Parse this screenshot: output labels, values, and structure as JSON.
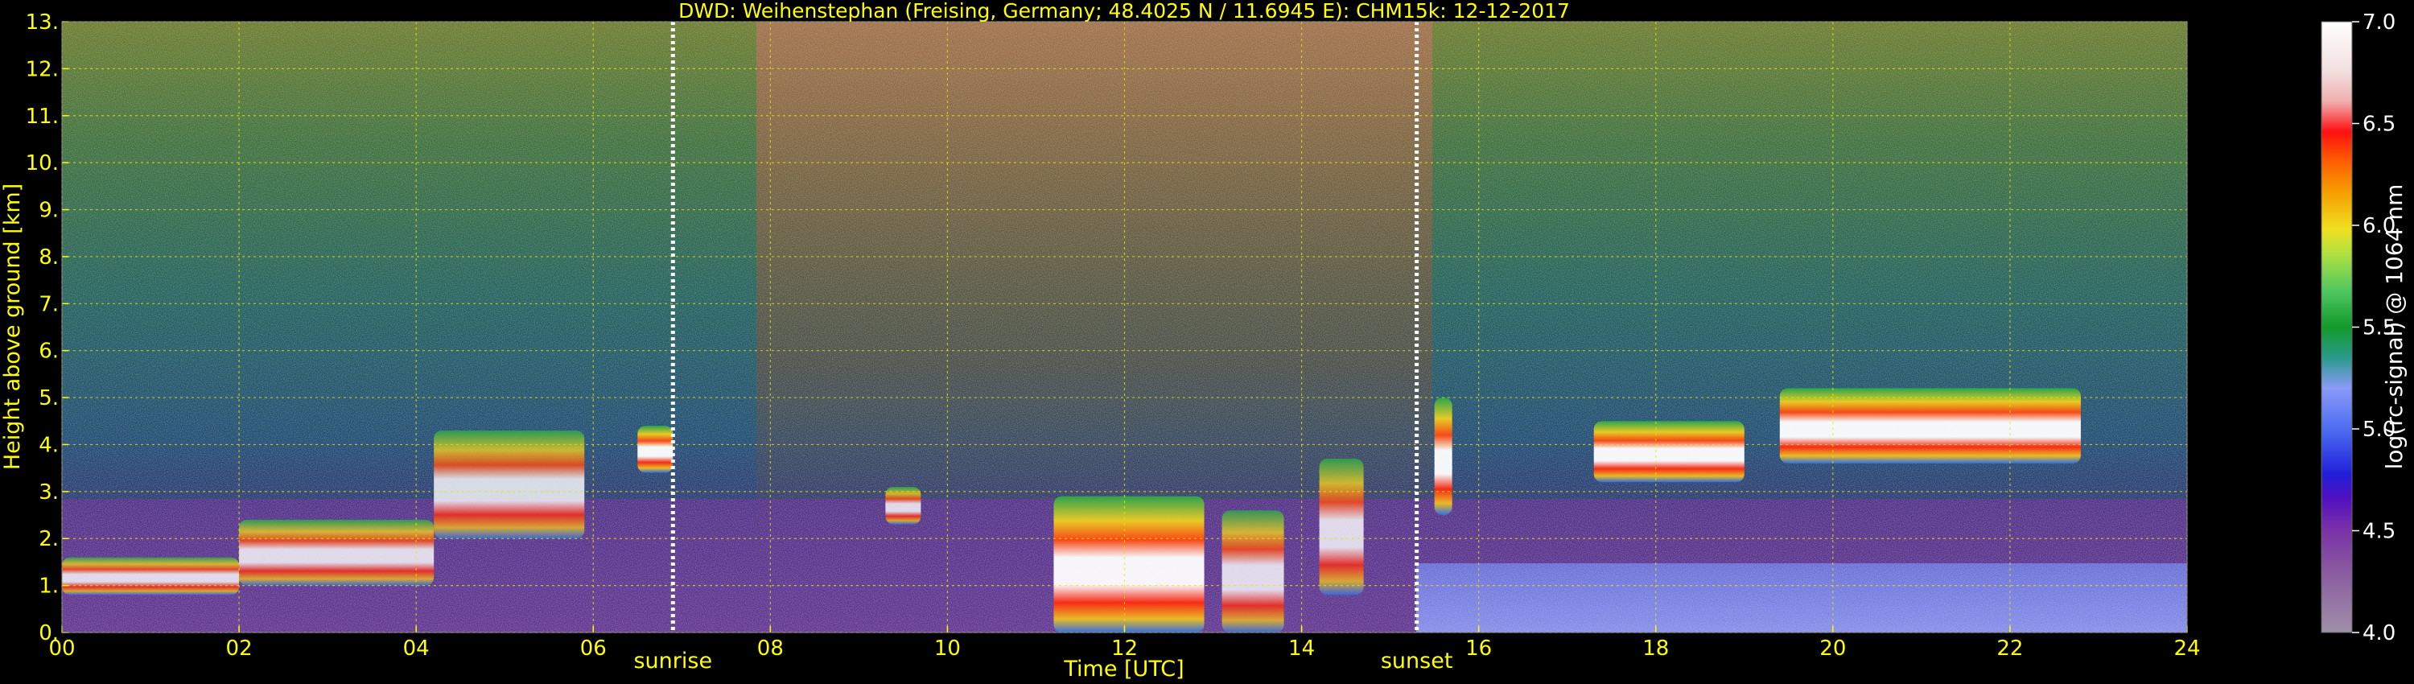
{
  "chart_data": {
    "type": "heatmap",
    "title": "DWD: Weihenstephan (Freising, Germany; 48.4025 N / 11.6945 E):    CHM15k: 12-12-2017",
    "xlabel": "Time [UTC]",
    "ylabel": "Height above ground [km]",
    "colorbar_label": "log(rc-signal) @ 1064 nm",
    "xlim": [
      0,
      24
    ],
    "ylim": [
      0,
      13
    ],
    "clim": [
      4.0,
      7.0
    ],
    "x_ticks": [
      "00",
      "02",
      "04",
      "06",
      "08",
      "10",
      "12",
      "14",
      "16",
      "18",
      "20",
      "22",
      "24"
    ],
    "y_ticks": [
      "0.",
      "1.",
      "2.",
      "3.",
      "4.",
      "5.",
      "6.",
      "7.",
      "8.",
      "9.",
      "10.",
      "11.",
      "12.",
      "13."
    ],
    "colorbar_ticks": [
      "4.0",
      "4.5",
      "5.0",
      "5.5",
      "6.0",
      "6.5",
      "7.0"
    ],
    "grid": true,
    "markers": [
      {
        "label": "sunrise",
        "time": 6.9
      },
      {
        "label": "sunset",
        "time": 15.3
      }
    ],
    "layers": [
      {
        "start": 0.0,
        "end": 2.0,
        "base": 0.8,
        "top": 1.6,
        "value": 6.3
      },
      {
        "start": 2.0,
        "end": 4.2,
        "base": 1.0,
        "top": 2.4,
        "value": 6.2
      },
      {
        "start": 4.2,
        "end": 5.9,
        "base": 2.0,
        "top": 4.3,
        "value": 6.0
      },
      {
        "start": 6.5,
        "end": 6.9,
        "base": 3.4,
        "top": 4.4,
        "value": 6.5
      },
      {
        "start": 9.3,
        "end": 9.7,
        "base": 2.3,
        "top": 3.1,
        "value": 5.8
      },
      {
        "start": 11.2,
        "end": 12.9,
        "base": 0.0,
        "top": 2.9,
        "value": 6.5
      },
      {
        "start": 13.1,
        "end": 13.8,
        "base": 0.0,
        "top": 2.6,
        "value": 6.0
      },
      {
        "start": 14.2,
        "end": 14.7,
        "base": 0.8,
        "top": 3.7,
        "value": 6.2
      },
      {
        "start": 15.5,
        "end": 15.7,
        "base": 2.5,
        "top": 5.0,
        "value": 6.5
      },
      {
        "start": 17.3,
        "end": 19.0,
        "base": 3.2,
        "top": 4.5,
        "value": 6.8
      },
      {
        "start": 19.4,
        "end": 22.8,
        "base": 3.6,
        "top": 5.2,
        "value": 6.8
      }
    ]
  }
}
